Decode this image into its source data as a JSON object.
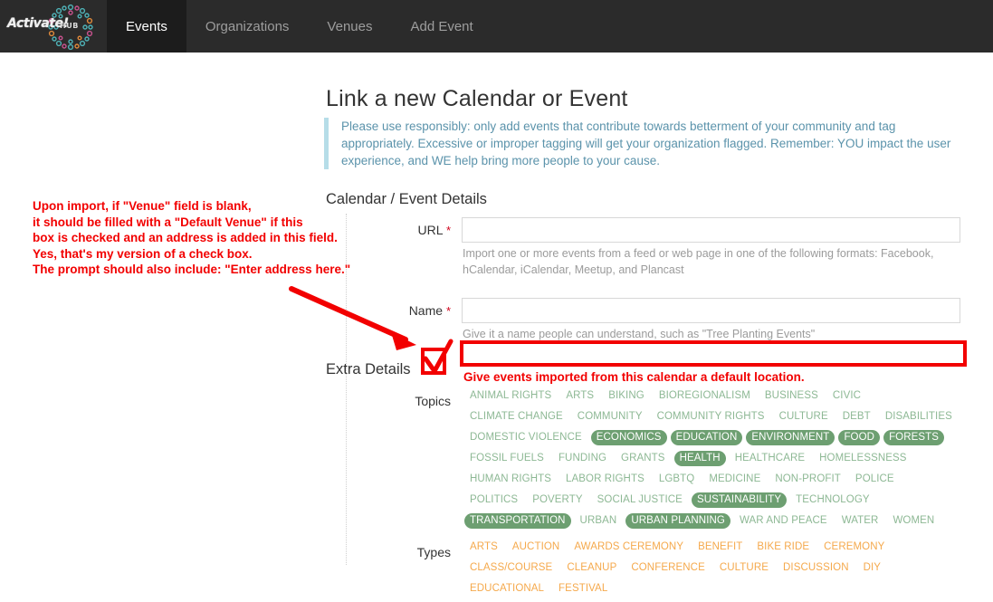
{
  "navbar": {
    "brand": {
      "word": "Activate!",
      "hub": "HUB",
      "icon": "ring-of-circles-logo"
    },
    "items": [
      {
        "label": "Events",
        "active": true
      },
      {
        "label": "Organizations",
        "active": false
      },
      {
        "label": "Venues",
        "active": false
      },
      {
        "label": "Add Event",
        "active": false
      }
    ]
  },
  "page": {
    "title": "Link a new Calendar or Event",
    "notice": "Please use responsibly: only add events that contribute towards betterment of your community and tag appropriately. Excessive or improper tagging will get your organization flagged. Remember: YOU impact the user experience, and WE help bring more people to your cause."
  },
  "sections": {
    "calendar_event_details": "Calendar / Event Details",
    "extra_details": "Extra Details"
  },
  "fields": {
    "url": {
      "label": "URL",
      "required_marker": "*",
      "value": "",
      "placeholder": "",
      "help": "Import one or more events from a feed or web page in one of the following formats: Facebook, hCalendar, iCalendar, Meetup, and Plancast"
    },
    "name": {
      "label": "Name",
      "required_marker": "*",
      "value": "",
      "placeholder": "",
      "help": "Give it a name people can understand, such as \"Tree Planting Events\""
    },
    "default_location": {
      "value": "",
      "placeholder": "",
      "caption": "Give events imported from this calendar a default location."
    }
  },
  "annotation": {
    "lines": [
      "Upon import, if \"Venue\" field is blank,",
      "it should be filled with a \"Default Venue\" if this",
      "box is checked and an address is added in this field.",
      "Yes, that's my version of a check box.",
      "The prompt should also include: \"Enter address here.\""
    ],
    "arrow": "red-arrow-annotation",
    "checkbox": "hand-drawn-checkbox-annotation",
    "color": "#f20000"
  },
  "topics": {
    "label": "Topics",
    "color_unselected": "#8db894",
    "color_selected_bg": "#6d9f71",
    "tags": [
      {
        "label": "ANIMAL RIGHTS",
        "selected": false
      },
      {
        "label": "ARTS",
        "selected": false
      },
      {
        "label": "BIKING",
        "selected": false
      },
      {
        "label": "BIOREGIONALISM",
        "selected": false
      },
      {
        "label": "BUSINESS",
        "selected": false
      },
      {
        "label": "CIVIC",
        "selected": false
      },
      {
        "label": "CLIMATE CHANGE",
        "selected": false
      },
      {
        "label": "COMMUNITY",
        "selected": false
      },
      {
        "label": "COMMUNITY RIGHTS",
        "selected": false
      },
      {
        "label": "CULTURE",
        "selected": false
      },
      {
        "label": "DEBT",
        "selected": false
      },
      {
        "label": "DISABILITIES",
        "selected": false
      },
      {
        "label": "DOMESTIC VIOLENCE",
        "selected": false
      },
      {
        "label": "ECONOMICS",
        "selected": true
      },
      {
        "label": "EDUCATION",
        "selected": true
      },
      {
        "label": "ENVIRONMENT",
        "selected": true
      },
      {
        "label": "FOOD",
        "selected": true
      },
      {
        "label": "FORESTS",
        "selected": true
      },
      {
        "label": "FOSSIL FUELS",
        "selected": false
      },
      {
        "label": "FUNDING",
        "selected": false
      },
      {
        "label": "GRANTS",
        "selected": false
      },
      {
        "label": "HEALTH",
        "selected": true
      },
      {
        "label": "HEALTHCARE",
        "selected": false
      },
      {
        "label": "HOMELESSNESS",
        "selected": false
      },
      {
        "label": "HUMAN RIGHTS",
        "selected": false
      },
      {
        "label": "LABOR RIGHTS",
        "selected": false
      },
      {
        "label": "LGBTQ",
        "selected": false
      },
      {
        "label": "MEDICINE",
        "selected": false
      },
      {
        "label": "NON-PROFIT",
        "selected": false
      },
      {
        "label": "POLICE",
        "selected": false
      },
      {
        "label": "POLITICS",
        "selected": false
      },
      {
        "label": "POVERTY",
        "selected": false
      },
      {
        "label": "SOCIAL JUSTICE",
        "selected": false
      },
      {
        "label": "SUSTAINABILITY",
        "selected": true
      },
      {
        "label": "TECHNOLOGY",
        "selected": false
      },
      {
        "label": "TRANSPORTATION",
        "selected": true
      },
      {
        "label": "URBAN",
        "selected": false
      },
      {
        "label": "URBAN PLANNING",
        "selected": true
      },
      {
        "label": "WAR AND PEACE",
        "selected": false
      },
      {
        "label": "WATER",
        "selected": false
      },
      {
        "label": "WOMEN",
        "selected": false
      }
    ]
  },
  "types": {
    "label": "Types",
    "color_unselected": "#f5a94c",
    "tags": [
      {
        "label": "ARTS",
        "selected": false
      },
      {
        "label": "AUCTION",
        "selected": false
      },
      {
        "label": "AWARDS CEREMONY",
        "selected": false
      },
      {
        "label": "BENEFIT",
        "selected": false
      },
      {
        "label": "BIKE RIDE",
        "selected": false
      },
      {
        "label": "CEREMONY",
        "selected": false
      },
      {
        "label": "CLASS/COURSE",
        "selected": false
      },
      {
        "label": "CLEANUP",
        "selected": false
      },
      {
        "label": "CONFERENCE",
        "selected": false
      },
      {
        "label": "CULTURE",
        "selected": false
      },
      {
        "label": "DISCUSSION",
        "selected": false
      },
      {
        "label": "DIY",
        "selected": false
      },
      {
        "label": "EDUCATIONAL",
        "selected": false
      },
      {
        "label": "FESTIVAL",
        "selected": false
      }
    ]
  }
}
